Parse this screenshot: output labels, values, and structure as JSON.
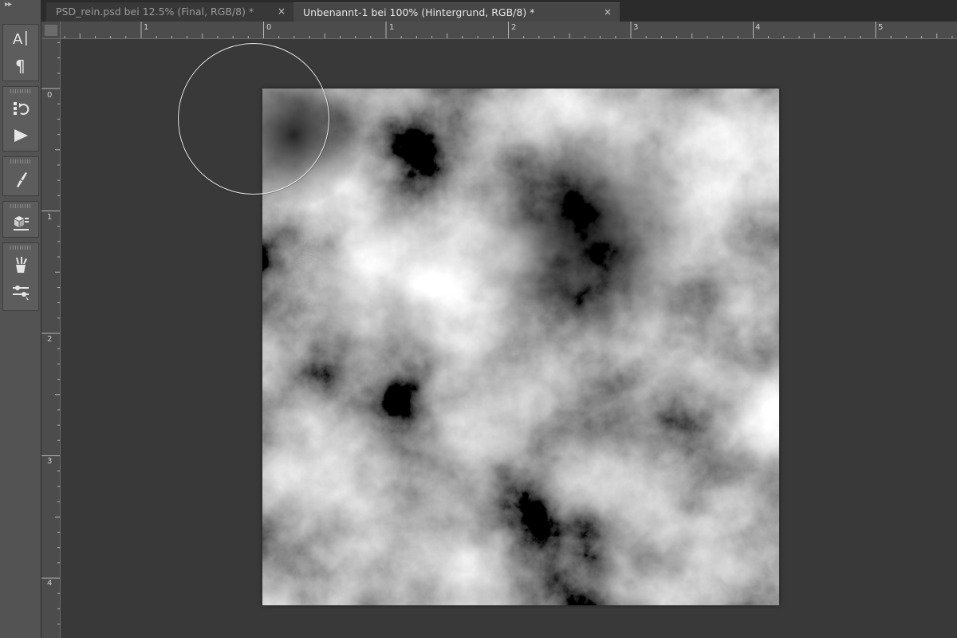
{
  "tabs": [
    {
      "label": "PSD_rein.psd bei 12.5% (Final, RGB/8) *",
      "close": "×",
      "active": false
    },
    {
      "label": "Unbenannt-1 bei 100% (Hintergrund, RGB/8) *",
      "close": "×",
      "active": true
    }
  ],
  "toolpanel": {
    "collapse_label": "▸▸",
    "groups": [
      {
        "tools": [
          {
            "name": "character-tool",
            "glyph": "A|"
          },
          {
            "name": "paragraph-tool",
            "glyph": "¶"
          }
        ]
      },
      {
        "tools": [
          {
            "name": "history-tool",
            "glyph": "history"
          },
          {
            "name": "actions-play-tool",
            "glyph": "play"
          }
        ]
      },
      {
        "tools": [
          {
            "name": "brush-presets-tool",
            "glyph": "brush"
          }
        ]
      },
      {
        "tools": [
          {
            "name": "3d-tool",
            "glyph": "3d"
          }
        ]
      },
      {
        "tools": [
          {
            "name": "tool-presets-tool",
            "glyph": "presets"
          },
          {
            "name": "adjustments-tool",
            "glyph": "adjust"
          }
        ]
      }
    ]
  },
  "ruler_horizontal": {
    "labels": [
      "1",
      "0",
      "1",
      "2",
      "3",
      "4",
      "5"
    ]
  },
  "ruler_vertical": {
    "labels": [
      "0",
      "1",
      "2",
      "3",
      "4"
    ]
  },
  "colors": {
    "background": "#3a3a3a",
    "panel": "#535353",
    "tabbar": "#2b2b2b",
    "ruler": "#4c4c4c",
    "canvas_dark": "#0d0d0d",
    "canvas_light": "#a8a8a8",
    "brush_cursor": "#e9e9e9"
  },
  "canvas": {
    "content": "clouds-render",
    "layer": "Hintergrund"
  }
}
